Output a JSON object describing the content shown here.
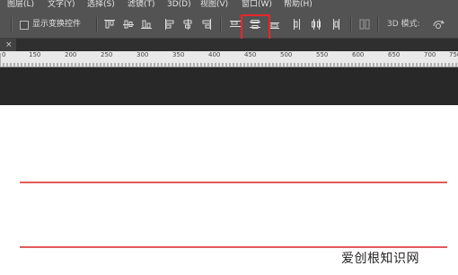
{
  "menu": [
    "图层(L)",
    "文字(Y)",
    "选择(S)",
    "滤镜(T)",
    "3D(D)",
    "视图(V)",
    "窗口(W)",
    "帮助(H)"
  ],
  "options": {
    "show_transform_controls": "显示变换控件",
    "mode_3d": "3D 模式:"
  },
  "tab": {
    "close": "×"
  },
  "ruler": {
    "labels": [
      "0",
      "150",
      "200",
      "250",
      "300",
      "350",
      "400",
      "450",
      "500",
      "550",
      "600",
      "650",
      "700",
      "750"
    ]
  },
  "watermark": "爱创根知识网",
  "colors": {
    "highlight": "#e8262a",
    "guide": "#e25b5b",
    "ui": "#535353"
  },
  "icons": [
    "align-top-edges-icon",
    "align-vertical-centers-icon",
    "align-bottom-edges-icon",
    "align-left-edges-icon",
    "align-horizontal-centers-icon",
    "align-right-edges-icon",
    "distribute-top-edges-icon",
    "distribute-vertical-centers-icon",
    "distribute-bottom-edges-icon",
    "distribute-left-edges-icon",
    "distribute-horizontal-centers-icon",
    "distribute-right-edges-icon",
    "auto-align-layers-icon",
    "3d-rotate-icon"
  ]
}
